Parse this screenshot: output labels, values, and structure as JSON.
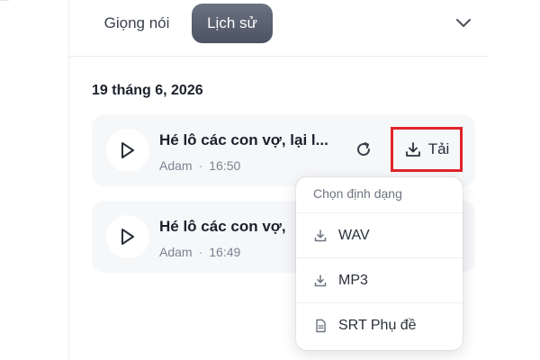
{
  "tabs": [
    {
      "label": "Giọng nói",
      "active": false
    },
    {
      "label": "Lịch sử",
      "active": true
    }
  ],
  "history": {
    "date_heading": "19 tháng 6, 2026",
    "items": [
      {
        "title": "Hé lô các con vợ, lại l...",
        "voice": "Adam",
        "time": "16:50"
      },
      {
        "title": "Hé lô các con vợ,",
        "voice": "Adam",
        "time": "16:49"
      }
    ]
  },
  "download": {
    "label": "Tải"
  },
  "format_menu": {
    "header": "Chọn định dạng",
    "options": [
      {
        "label": "WAV",
        "icon": "download-icon"
      },
      {
        "label": "MP3",
        "icon": "download-icon"
      },
      {
        "label": "SRT Phụ đề",
        "icon": "document-icon"
      }
    ]
  },
  "colors": {
    "active_tab": "#5a6170",
    "highlight_border": "#e0242a",
    "card_bg": "#f6f7f9"
  }
}
